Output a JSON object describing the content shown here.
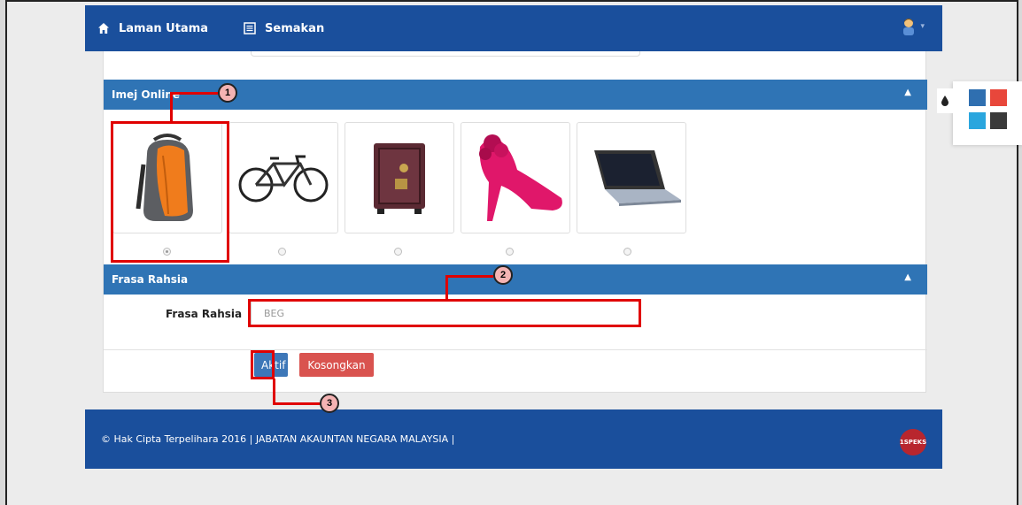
{
  "nav": {
    "home_label": "Laman Utama",
    "review_label": "Semakan"
  },
  "image_panel": {
    "title": "Imej Online",
    "images": [
      {
        "icon": "backpack-icon",
        "selected": true
      },
      {
        "icon": "bicycle-icon",
        "selected": false
      },
      {
        "icon": "safe-icon",
        "selected": false
      },
      {
        "icon": "high-heel-shoe-icon",
        "selected": false
      },
      {
        "icon": "laptop-icon",
        "selected": false
      }
    ]
  },
  "phrase_panel": {
    "title": "Frasa Rahsia",
    "field_label": "Frasa Rahsia",
    "field_value": "BEG"
  },
  "actions": {
    "activate_label": "Aktif",
    "clear_label": "Kosongkan"
  },
  "footer": {
    "copyright": "© Hak Cipta Terpelihara 2016 | JABATAN AKAUNTAN NEGARA MALAYSIA |",
    "logo_text": "1SPEKS"
  },
  "callouts": {
    "one": "1",
    "two": "2",
    "three": "3"
  },
  "theme_swatches": [
    "#2f6fb0",
    "#e8473b",
    "#2aa6de",
    "#3a3a3a"
  ],
  "colors": {
    "nav_bg": "#1a4f9c",
    "panel_head_bg": "#2f74b5",
    "highlight": "#e00000"
  }
}
